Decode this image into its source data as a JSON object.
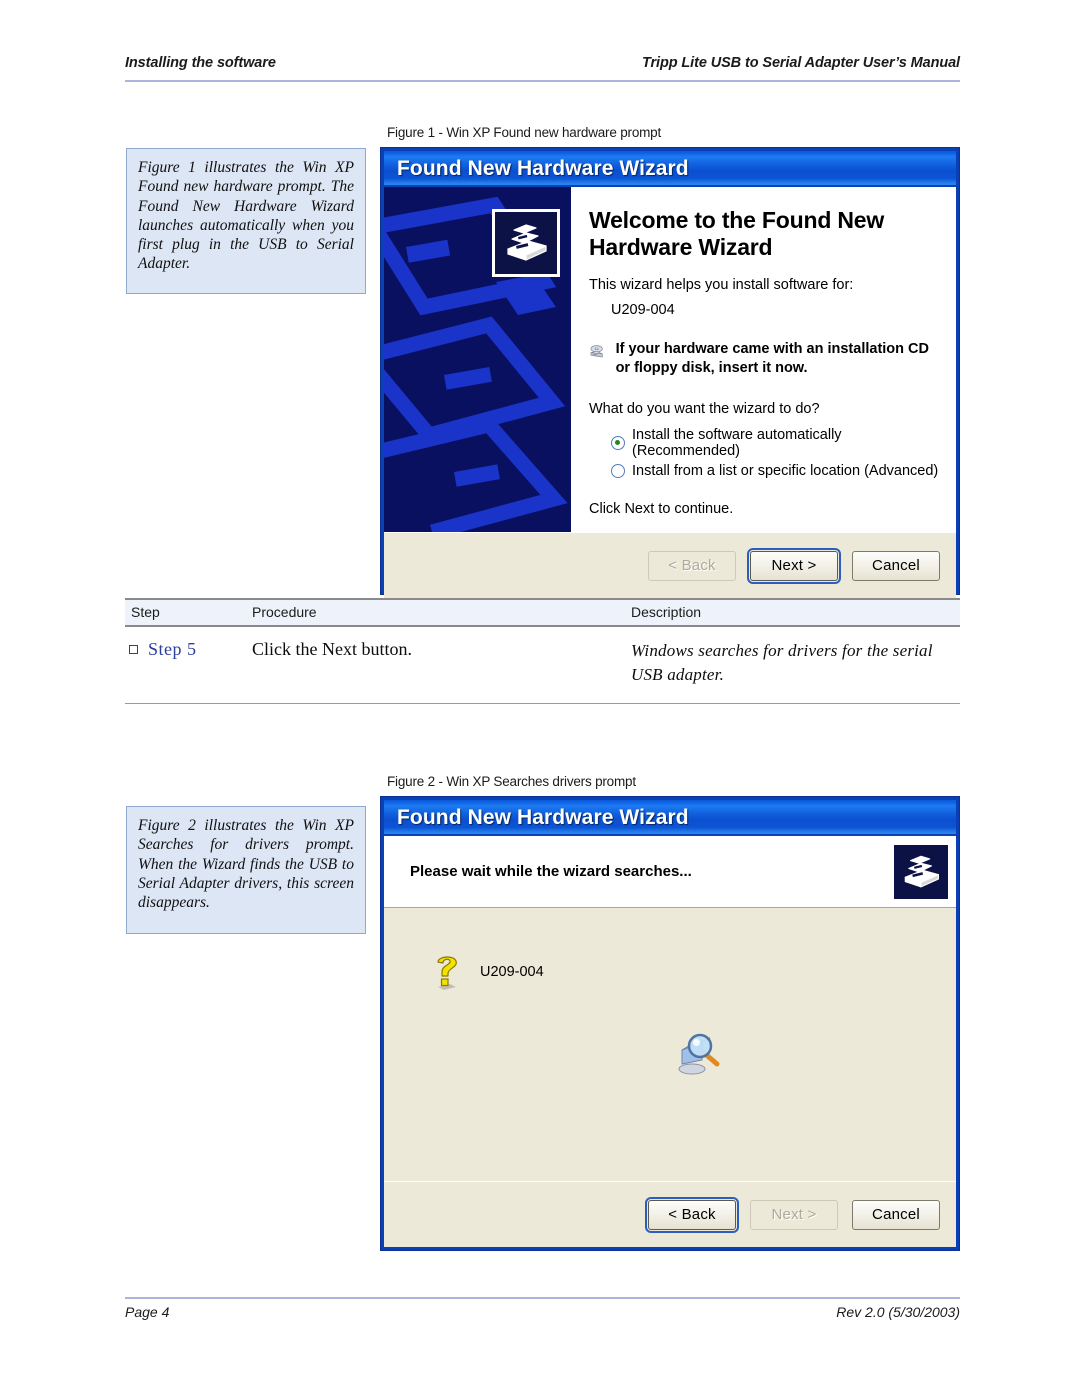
{
  "header": {
    "left": "Installing the software",
    "right": "Tripp Lite USB to Serial Adapter User’s Manual"
  },
  "footer": {
    "left": "Page 4",
    "right": "Rev 2.0 (5/30/2003)"
  },
  "sidenotes": [
    {
      "id": "sidenote-figure-1",
      "text": "Figure 1 illustrates the Win XP Found new hardware prompt. The Found New Hardware Wizard launches automatically when you first plug in the USB to Serial Adapter."
    },
    {
      "id": "sidenote-figure-2",
      "text": "Figure 2 illustrates the Win XP Searches for drivers prompt. When the Wizard finds the USB to Serial Adapter drivers, this screen disappears."
    }
  ],
  "figure1": {
    "caption": "Figure 1 - Win XP Found new hardware prompt",
    "title": "Found New Hardware Wizard",
    "heading": "Welcome to the Found New Hardware Wizard",
    "intro": "This wizard helps you install software for:",
    "device": "U209-004",
    "cd_notice": "If your hardware came with an installation CD or floppy disk, insert it now.",
    "question": "What do you want the wizard to do?",
    "options": [
      {
        "label": "Install the software automatically (Recommended)",
        "selected": true
      },
      {
        "label": "Install from a list or specific location (Advanced)",
        "selected": false
      }
    ],
    "click_next": "Click Next to continue.",
    "buttons": [
      {
        "label": "< Back",
        "state": "disabled"
      },
      {
        "label": "Next >",
        "state": "focused"
      },
      {
        "label": "Cancel",
        "state": "normal"
      }
    ]
  },
  "figure2": {
    "caption": "Figure 2 - Win XP Searches drivers prompt",
    "title": "Found New Hardware Wizard",
    "heading": "Please wait while the wizard searches...",
    "device": "U209-004",
    "buttons": [
      {
        "label": "< Back",
        "state": "focused"
      },
      {
        "label": "Next >",
        "state": "disabled"
      },
      {
        "label": "Cancel",
        "state": "normal"
      }
    ]
  },
  "table": {
    "columns": [
      "Step",
      "Procedure",
      "Description"
    ],
    "rows": [
      {
        "step": "Step 5",
        "procedure": "Click the Next button.",
        "description": "Windows searches for drivers for the serial USB adapter."
      }
    ]
  },
  "colors": {
    "sidenote_bg": "#DCE6F5",
    "sidenote_border": "#8FA8CE",
    "rule": "#AAB4DD",
    "xp_title_blue": "#0B4FD0",
    "xp_face": "#ECE9D8",
    "xp_border": "#0B3FB5",
    "step_blue": "#2B3E9E",
    "panel_navy": "#0A1060"
  }
}
